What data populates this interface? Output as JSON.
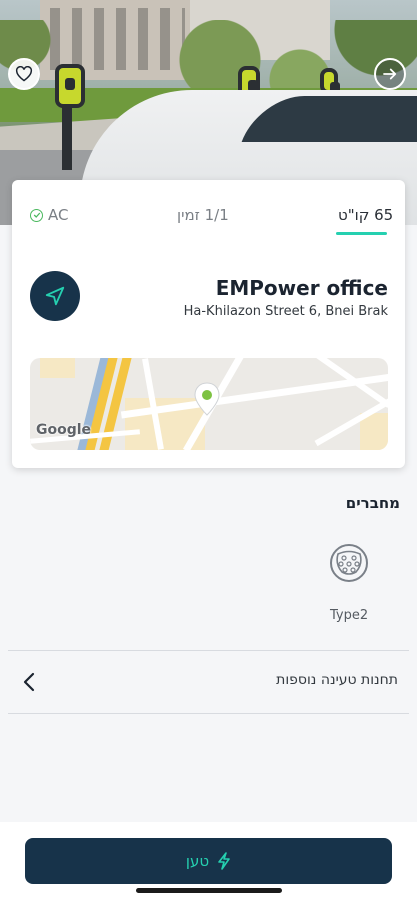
{
  "hero": {
    "favorite_icon": "heart-outline-icon",
    "share_icon": "arrow-right-circle-icon"
  },
  "station": {
    "tabs": {
      "ac_label": "AC",
      "ac_icon": "check-circle-icon",
      "availability": "1/1 זמין",
      "power": "65 קו\"ט"
    },
    "name": "EMPower office",
    "address": "Ha-Khilazon Street 6, Bnei Brak",
    "navigate_icon": "navigation-arrow-icon",
    "map": {
      "attribution": "Google",
      "pin_color": "#7dc242"
    }
  },
  "connectors": {
    "title": "מחברים",
    "items": [
      {
        "type": "Type2",
        "icon": "type2-connector-icon"
      }
    ]
  },
  "more_stations": {
    "label": "תחנות טעינה נוספות",
    "icon": "chevron-left-icon"
  },
  "charge_button": {
    "label": "טען",
    "icon": "lightning-bolt-icon"
  },
  "colors": {
    "primary_dark": "#17334a",
    "accent_teal": "#25d0b0",
    "available_green": "#4bb85f"
  }
}
